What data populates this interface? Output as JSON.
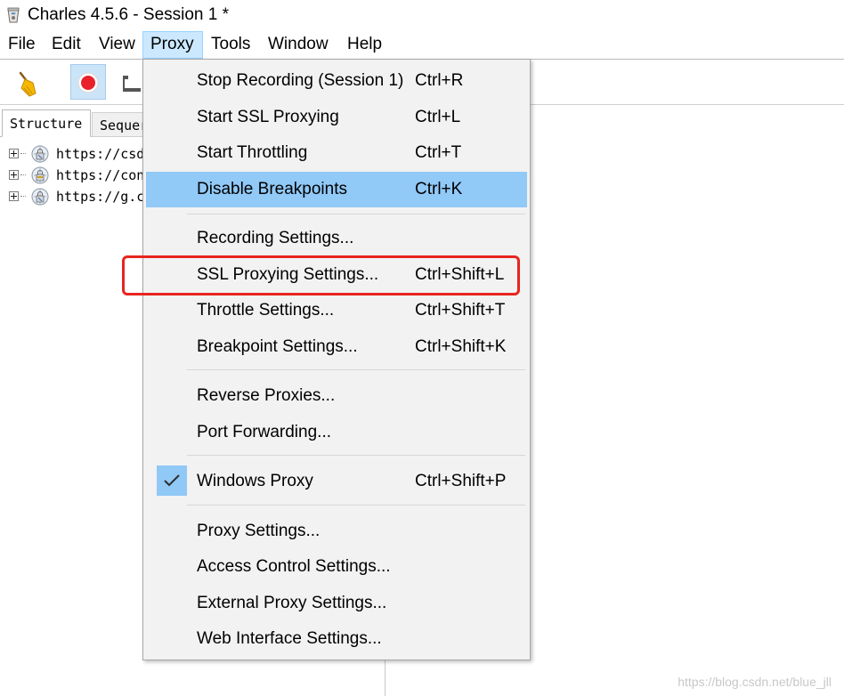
{
  "window": {
    "title": "Charles 4.5.6 - Session 1 *"
  },
  "menubar": {
    "items": [
      {
        "label": "File"
      },
      {
        "label": "Edit"
      },
      {
        "label": "View"
      },
      {
        "label": "Proxy"
      },
      {
        "label": "Tools"
      },
      {
        "label": "Window"
      },
      {
        "label": "Help"
      }
    ],
    "active": "Proxy"
  },
  "toolbar": {
    "buttons": [
      {
        "icon": "broom-icon"
      },
      {
        "icon": "record-icon"
      },
      {
        "icon": "throttle-icon"
      }
    ]
  },
  "left": {
    "tabs": [
      "Structure",
      "Sequence"
    ],
    "tabs_visible": [
      "Structure",
      "Sequer"
    ],
    "tree": [
      {
        "url": "https://csd"
      },
      {
        "url": "https://con"
      },
      {
        "url": "https://g.c"
      }
    ]
  },
  "proxy_menu": {
    "groups": [
      [
        {
          "label": "Stop Recording (Session 1)",
          "shortcut": "Ctrl+R"
        },
        {
          "label": "Start SSL Proxying",
          "shortcut": "Ctrl+L"
        },
        {
          "label": "Start Throttling",
          "shortcut": "Ctrl+T"
        },
        {
          "label": "Disable Breakpoints",
          "shortcut": "Ctrl+K",
          "highlighted": true
        }
      ],
      [
        {
          "label": "Recording Settings...",
          "shortcut": ""
        },
        {
          "label": "SSL Proxying Settings...",
          "shortcut": "Ctrl+Shift+L",
          "annotated": true
        },
        {
          "label": "Throttle Settings...",
          "shortcut": "Ctrl+Shift+T"
        },
        {
          "label": "Breakpoint Settings...",
          "shortcut": "Ctrl+Shift+K"
        }
      ],
      [
        {
          "label": "Reverse Proxies...",
          "shortcut": ""
        },
        {
          "label": "Port Forwarding...",
          "shortcut": ""
        }
      ],
      [
        {
          "label": "Windows Proxy",
          "shortcut": "Ctrl+Shift+P",
          "checked": true
        }
      ],
      [
        {
          "label": "Proxy Settings...",
          "shortcut": ""
        },
        {
          "label": "Access Control Settings...",
          "shortcut": ""
        },
        {
          "label": "External Proxy Settings...",
          "shortcut": ""
        },
        {
          "label": "Web Interface Settings...",
          "shortcut": ""
        }
      ]
    ]
  },
  "watermark": "https://blog.csdn.net/blue_jll",
  "colors": {
    "highlight": "#91c9f7",
    "menu_active": "#cce8ff",
    "annotation": "#e8251f",
    "record": "#e8212a"
  }
}
